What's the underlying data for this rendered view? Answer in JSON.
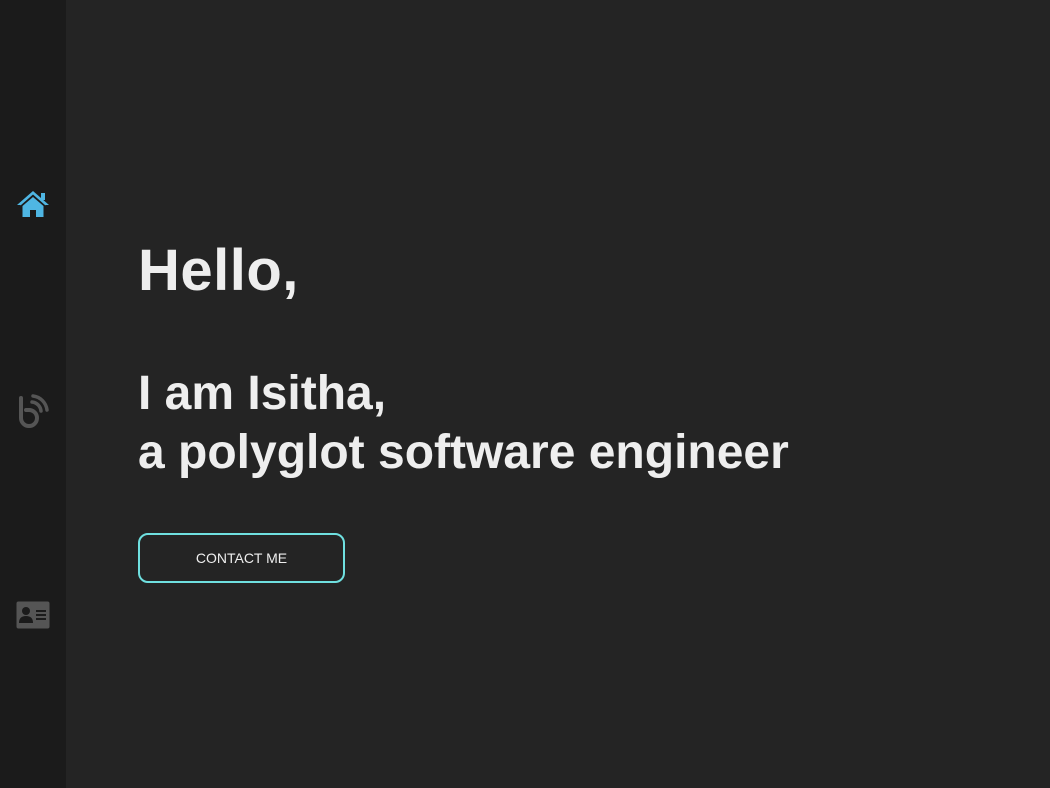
{
  "sidebar": {
    "items": [
      {
        "icon": "home-icon",
        "active": true,
        "color": "#4fb6e3"
      },
      {
        "icon": "blog-icon",
        "active": false,
        "color": "#555555"
      },
      {
        "icon": "contact-card-icon",
        "active": false,
        "color": "#555555"
      }
    ]
  },
  "hero": {
    "greeting": "Hello,",
    "line1": "I am Isitha,",
    "line2": "a polyglot software engineer",
    "button_label": "CONTACT ME"
  },
  "colors": {
    "background": "#242424",
    "sidebar": "#1b1b1b",
    "text": "#eeeeee",
    "accent": "#6fe0e0",
    "active_icon": "#4fb6e3"
  }
}
